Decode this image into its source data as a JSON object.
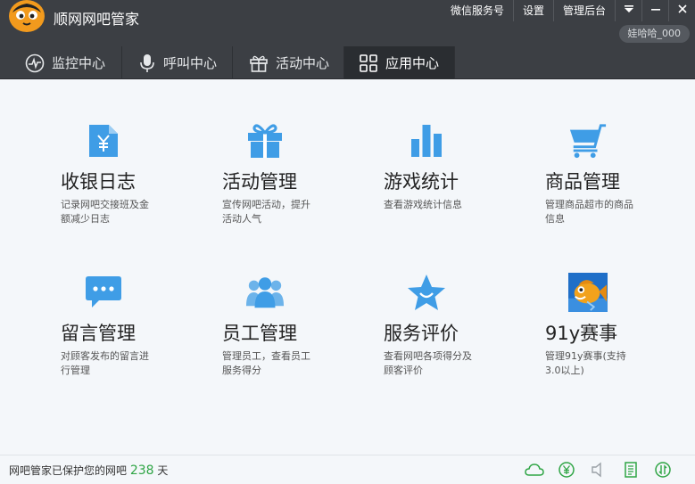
{
  "app": {
    "title": "顺网网吧管家"
  },
  "top_links": [
    "微信服务号",
    "设置",
    "管理后台"
  ],
  "user": {
    "name": "娃哈哈_000"
  },
  "tabs": [
    {
      "label": "监控中心",
      "icon": "monitor-icon"
    },
    {
      "label": "呼叫中心",
      "icon": "microphone-icon"
    },
    {
      "label": "活动中心",
      "icon": "gift-icon"
    },
    {
      "label": "应用中心",
      "icon": "grid-icon",
      "active": true
    }
  ],
  "apps": [
    {
      "title": "收银日志",
      "desc": "记录网吧交接班及金额减少日志",
      "icon": "receipt-yen-icon"
    },
    {
      "title": "活动管理",
      "desc": "宣传网吧活动，提升活动人气",
      "icon": "gift-box-icon"
    },
    {
      "title": "游戏统计",
      "desc": "查看游戏统计信息",
      "icon": "bar-chart-icon"
    },
    {
      "title": "商品管理",
      "desc": "管理商品超市的商品信息",
      "icon": "shopping-cart-icon"
    },
    {
      "title": "留言管理",
      "desc": "对顾客发布的留言进行管理",
      "icon": "chat-bubble-icon"
    },
    {
      "title": "员工管理",
      "desc": "管理员工，查看员工服务得分",
      "icon": "people-icon"
    },
    {
      "title": "服务评价",
      "desc": "查看网吧各项得分及顾客评价",
      "icon": "star-icon"
    },
    {
      "title": "91y赛事",
      "desc": "管理91y赛事(支持3.0以上)",
      "icon": "fish-mascot-icon"
    }
  ],
  "status": {
    "prefix": "网吧管家已保护您的网吧",
    "days": "238",
    "suffix": "天"
  },
  "colors": {
    "accent": "#3f9de6",
    "dark_bar": "#3c3f44",
    "success": "#2fa545"
  }
}
